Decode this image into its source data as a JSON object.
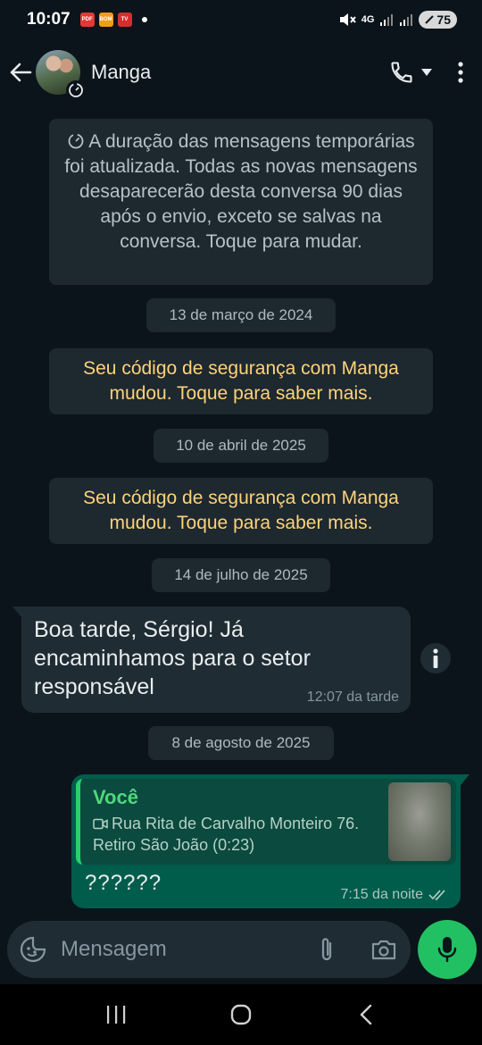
{
  "status_bar": {
    "time": "10:07",
    "notifications": [
      {
        "icon": "pdf-app-icon",
        "label": "PDF",
        "color": "#e53935"
      },
      {
        "icon": "news-app-icon",
        "label": "BOM DIA",
        "color": "#f39c12"
      },
      {
        "icon": "tv-app-icon",
        "label": "TV",
        "color": "#d32f2f"
      }
    ],
    "network": "4G",
    "battery": "75"
  },
  "header": {
    "contact_name": "Manga"
  },
  "chat": {
    "system_info": "A duração das mensagens temporárias foi atualizada. Todas as novas mensagens desaparecerão desta conversa 90 dias após o envio, exceto se salvas na conversa. Toque para mudar.",
    "date1": "13 de março de 2024",
    "security1": "Seu código de segurança com Manga mudou. Toque para saber mais.",
    "date2": "10 de abril de 2025",
    "security2": "Seu código de segurança com Manga mudou. Toque para saber mais.",
    "date3": "14 de julho de 2025",
    "incoming": {
      "text": "Boa tarde, Sérgio! Já encaminhamos para o setor responsável",
      "time": "12:07 da tarde"
    },
    "date4": "8 de agosto de 2025",
    "outgoing": {
      "quote_author": "Você",
      "quote_text": "Rua Rita de Carvalho Monteiro 76. Retiro São João (0:23)",
      "text": "??????",
      "time": "7:15 da noite"
    }
  },
  "composer": {
    "placeholder": "Mensagem"
  },
  "colors": {
    "background": "#0b141a",
    "incoming_bubble": "#1f2c33",
    "outgoing_bubble": "#005c4b",
    "accent_green": "#21c063",
    "security_text": "#ffd279"
  }
}
